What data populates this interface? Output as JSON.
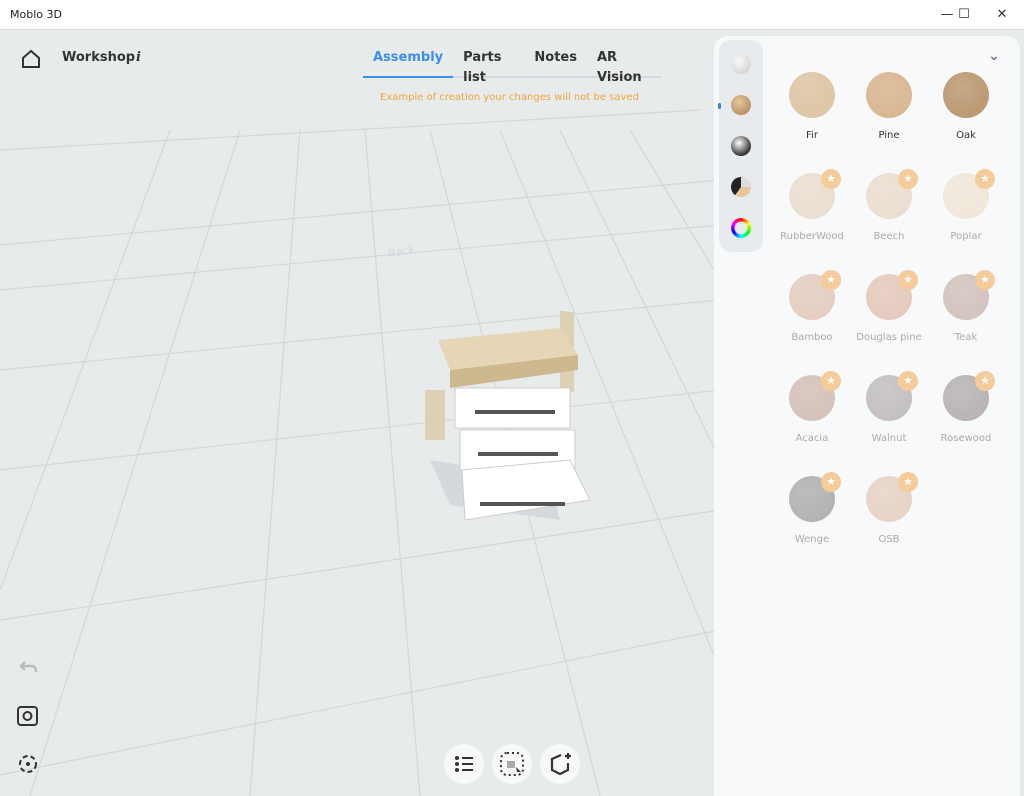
{
  "window": {
    "title": "Moblo 3D",
    "minimize": "—",
    "maximize": "☐",
    "close": "✕"
  },
  "header": {
    "project": "Workshop",
    "info": "i",
    "tabs": [
      {
        "label": "Assembly",
        "active": true
      },
      {
        "label": "Parts list"
      },
      {
        "label": "Notes"
      },
      {
        "label": "AR Vision"
      }
    ],
    "notice": "Example of creation your changes will not be saved"
  },
  "viewport": {
    "back_label": "Back"
  },
  "colors": {
    "accent": "#3a8ff2",
    "notice": "#f0a53a",
    "premium": "#f2a74a"
  },
  "panel": {
    "collapse": "⌄",
    "star": "★",
    "materials": [
      {
        "name": "Fir",
        "color": "#dcc3a0",
        "locked": false
      },
      {
        "name": "Pine",
        "color": "#d7b38b",
        "locked": false
      },
      {
        "name": "Oak",
        "color": "#b8946a",
        "locked": false
      },
      {
        "name": "RubberWood",
        "color": "#dfc6aa",
        "locked": true
      },
      {
        "name": "Beech",
        "color": "#e0c4aa",
        "locked": true
      },
      {
        "name": "Poplar",
        "color": "#ead7bb",
        "locked": true
      },
      {
        "name": "Bamboo",
        "color": "#d2a78c",
        "locked": true
      },
      {
        "name": "Douglas pine",
        "color": "#d49f85",
        "locked": true
      },
      {
        "name": "Teak",
        "color": "#b09384",
        "locked": true
      },
      {
        "name": "Acacia",
        "color": "#b3907f",
        "locked": true
      },
      {
        "name": "Walnut",
        "color": "#958c8c",
        "locked": true
      },
      {
        "name": "Rosewood",
        "color": "#7e7475",
        "locked": true
      },
      {
        "name": "Wenge",
        "color": "#727272",
        "locked": true
      },
      {
        "name": "OSB",
        "color": "#d8b196",
        "locked": true
      }
    ]
  }
}
